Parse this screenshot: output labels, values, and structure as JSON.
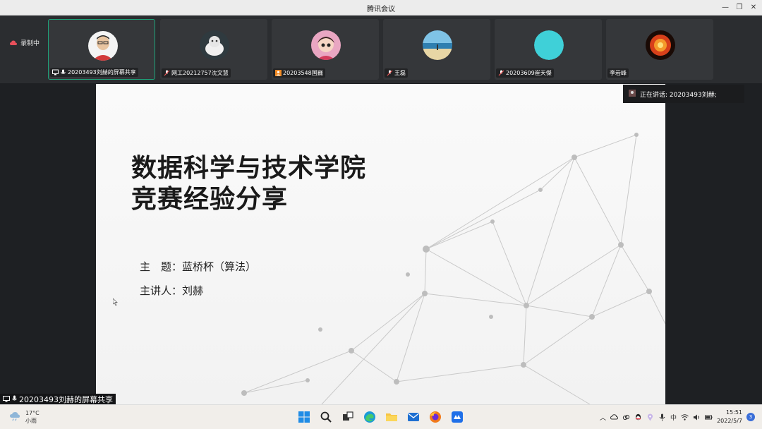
{
  "window": {
    "title": "腾讯会议"
  },
  "recording": {
    "label": "录制中"
  },
  "participants": [
    {
      "name": "20203493刘赫的屏幕共享",
      "avatar": "boy-photo",
      "active": true
    },
    {
      "name": "网工20212757沈文慧",
      "avatar": "cat-photo",
      "active": false
    },
    {
      "name": "20203548国巍",
      "avatar": "cartoon-girl",
      "active": false
    },
    {
      "name": "王磊",
      "avatar": "beach-photo",
      "active": false
    },
    {
      "name": "20203609崔天傑",
      "avatar": "cyan-circle",
      "active": false
    },
    {
      "name": "李岩峰",
      "avatar": "fire-photo",
      "active": false
    }
  ],
  "speaking": {
    "label": "正在讲话: 20203493刘赫;"
  },
  "slide": {
    "title_line1": "数据科学与技术学院",
    "title_line2": "竞赛经验分享",
    "topic": "主　题：蓝桥杯（算法）",
    "speaker": "主讲人：刘赫"
  },
  "share_tag": {
    "label": "20203493刘赫的屏幕共享"
  },
  "taskbar": {
    "weather_temp": "17°C",
    "weather_desc": "小雨",
    "ime": "中",
    "time": "15:51",
    "date": "2022/5/7",
    "notification_count": "3"
  },
  "colors": {
    "active_border": "#1fa37a",
    "slide_bg": "#f5f5f5",
    "app_bg": "#1e2023"
  }
}
